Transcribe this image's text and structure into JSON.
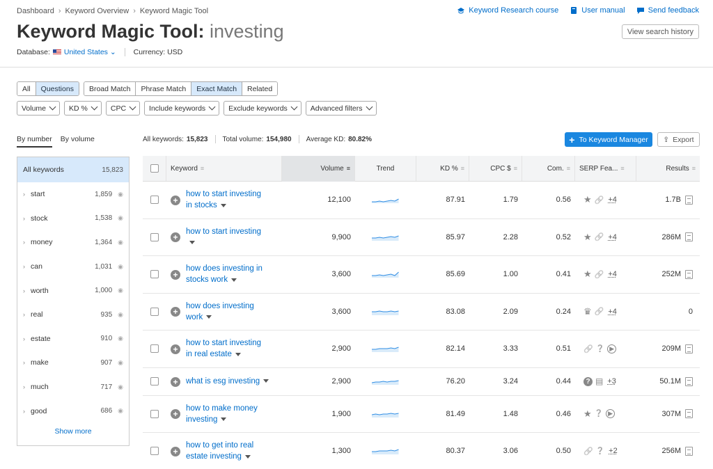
{
  "breadcrumb": [
    "Dashboard",
    "Keyword Overview",
    "Keyword Magic Tool"
  ],
  "top_links": {
    "course": "Keyword Research course",
    "manual": "User manual",
    "feedback": "Send feedback"
  },
  "page": {
    "title": "Keyword Magic Tool:",
    "query": "investing",
    "history_button": "View search history",
    "database_label": "Database:",
    "database_value": "United States",
    "currency_label": "Currency: USD"
  },
  "filters": {
    "match_tabs": [
      "All",
      "Questions",
      "Broad Match",
      "Phrase Match",
      "Exact Match",
      "Related"
    ],
    "dropdowns": [
      "Volume",
      "KD %",
      "CPC",
      "Include keywords",
      "Exclude keywords",
      "Advanced filters"
    ]
  },
  "side": {
    "tab_number": "By number",
    "tab_volume": "By volume",
    "all_label": "All keywords",
    "all_count": "15,823",
    "items": [
      {
        "label": "start",
        "count": "1,859"
      },
      {
        "label": "stock",
        "count": "1,538"
      },
      {
        "label": "money",
        "count": "1,364"
      },
      {
        "label": "can",
        "count": "1,031"
      },
      {
        "label": "worth",
        "count": "1,000"
      },
      {
        "label": "real",
        "count": "935"
      },
      {
        "label": "estate",
        "count": "910"
      },
      {
        "label": "make",
        "count": "907"
      },
      {
        "label": "much",
        "count": "717"
      },
      {
        "label": "good",
        "count": "686"
      }
    ],
    "show_more": "Show more"
  },
  "stats": {
    "all_kw_label": "All keywords:",
    "all_kw_value": "15,823",
    "total_vol_label": "Total volume:",
    "total_vol_value": "154,980",
    "avg_kd_label": "Average KD:",
    "avg_kd_value": "80.82%"
  },
  "actions": {
    "to_manager": "To Keyword Manager",
    "export": "Export"
  },
  "table": {
    "headers": [
      "Keyword",
      "Volume",
      "Trend",
      "KD %",
      "CPC $",
      "Com.",
      "SERP Fea...",
      "Results"
    ],
    "rows": [
      {
        "kw1": "how to start investing",
        "kw2": "in stocks",
        "volume": "12,100",
        "kd": "87.91",
        "cpc": "1.79",
        "com": "0.56",
        "serp": [
          "star-icon",
          "link-icon"
        ],
        "more": "+4",
        "results": "1.7B"
      },
      {
        "kw1": "how to start investing",
        "kw2": "",
        "volume": "9,900",
        "kd": "85.97",
        "cpc": "2.28",
        "com": "0.52",
        "serp": [
          "star-icon",
          "link-icon"
        ],
        "more": "+4",
        "results": "286M"
      },
      {
        "kw1": "how does investing in",
        "kw2": "stocks work",
        "volume": "3,600",
        "kd": "85.69",
        "cpc": "1.00",
        "com": "0.41",
        "serp": [
          "star-icon",
          "link-icon"
        ],
        "more": "+4",
        "results": "252M"
      },
      {
        "kw1": "how does investing",
        "kw2": "work",
        "volume": "3,600",
        "kd": "83.08",
        "cpc": "2.09",
        "com": "0.24",
        "serp": [
          "crown-icon",
          "link-icon"
        ],
        "more": "+4",
        "results": "0"
      },
      {
        "kw1": "how to start investing",
        "kw2": "in real estate",
        "volume": "2,900",
        "kd": "82.14",
        "cpc": "3.33",
        "com": "0.51",
        "serp": [
          "link-icon",
          "question-icon",
          "video-icon"
        ],
        "more": "",
        "results": "209M"
      },
      {
        "kw1": "what is esg investing",
        "kw2": "",
        "volume": "2,900",
        "kd": "76.20",
        "cpc": "3.24",
        "com": "0.44",
        "serp": [
          "faq-icon",
          "news-icon"
        ],
        "more": "+3",
        "results": "50.1M"
      },
      {
        "kw1": "how to make money",
        "kw2": "investing",
        "volume": "1,900",
        "kd": "81.49",
        "cpc": "1.48",
        "com": "0.46",
        "serp": [
          "star-icon",
          "question-icon",
          "video-icon"
        ],
        "more": "",
        "results": "307M"
      },
      {
        "kw1": "how to get into real",
        "kw2": "estate investing",
        "volume": "1,300",
        "kd": "80.37",
        "cpc": "3.06",
        "com": "0.50",
        "serp": [
          "link-icon",
          "question-icon"
        ],
        "more": "+2",
        "results": "256M"
      }
    ]
  }
}
